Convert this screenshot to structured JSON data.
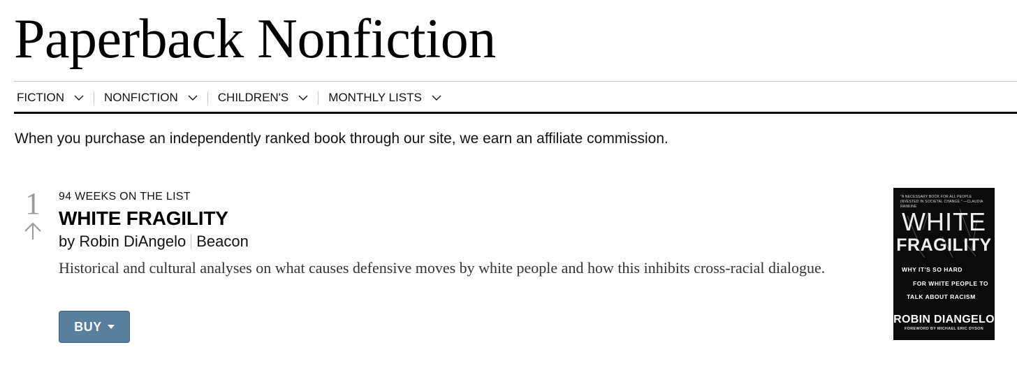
{
  "page": {
    "title": "Paperback Nonfiction"
  },
  "nav": {
    "items": [
      {
        "label": "FICTION",
        "icon": "chevron-down-icon"
      },
      {
        "label": "NONFICTION",
        "icon": "chevron-down-icon"
      },
      {
        "label": "CHILDREN'S",
        "icon": "chevron-down-icon"
      },
      {
        "label": "MONTHLY LISTS",
        "icon": "chevron-down-icon"
      }
    ]
  },
  "disclaimer": "When you purchase an independently ranked book through our site, we earn an affiliate commission.",
  "book": {
    "rank": "1",
    "rank_change_icon": "arrow-up-icon",
    "weeks_on_list": "94 WEEKS ON THE LIST",
    "title": "WHITE FRAGILITY",
    "author": "by Robin DiAngelo",
    "publisher": "Beacon",
    "description": "Historical and cultural analyses on what causes defensive moves by white people and how this inhibits cross-racial dialogue.",
    "buy_label": "BUY",
    "buy_icon": "caret-down-icon",
    "cover": {
      "blurb": "\"A NECESSARY BOOK FOR ALL PEOPLE INVESTED IN SOCIETAL CHANGE.\" —CLAUDIA RANKINE",
      "title_line1": "WHITE",
      "title_line2": "FRAGILITY",
      "subtitle_line1": "WHY IT'S SO HARD",
      "subtitle_line2": "FOR WHITE PEOPLE TO",
      "subtitle_line3": "TALK ABOUT RACISM",
      "author": "ROBIN DIANGELO",
      "foreword": "FOREWORD BY MICHAEL ERIC DYSON"
    }
  },
  "colors": {
    "buy_button": "#5a7f9e",
    "rank_gray": "#999999",
    "rule": "#c7c7c7"
  }
}
